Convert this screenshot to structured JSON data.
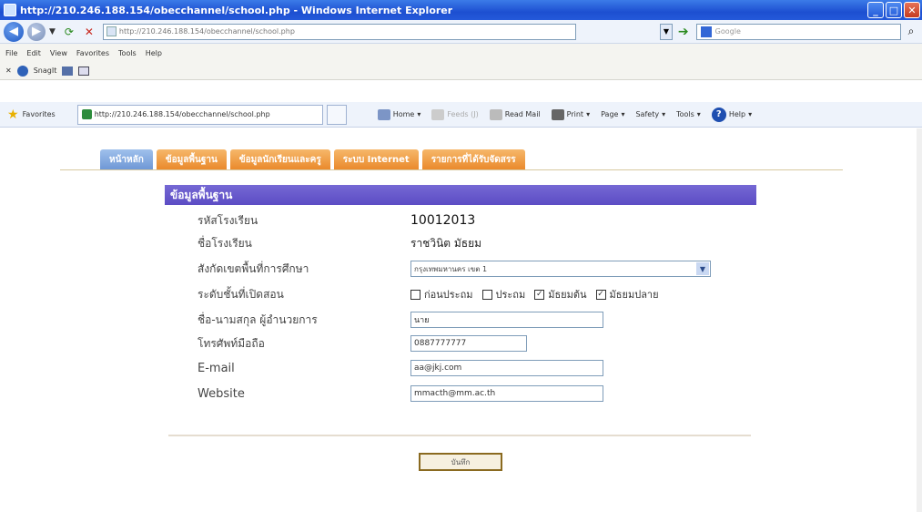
{
  "window": {
    "title": "http://210.246.188.154/obecchannel/school.php - Windows Internet Explorer",
    "min": "_",
    "max": "□",
    "close": "✕"
  },
  "address": {
    "url": "http://210.246.188.154/obecchannel/school.php",
    "search_placeholder": "Google"
  },
  "menu": {
    "items": [
      "File",
      "Edit",
      "View",
      "Favorites",
      "Tools",
      "Help"
    ]
  },
  "toolbar": {
    "snagit": "SnagIt"
  },
  "favorites_bar": {
    "favorites_label": "Favorites",
    "tab_title": "http://210.246.188.154/obecchannel/school.php",
    "home": "Home",
    "feeds": "Feeds (J)",
    "read_mail": "Read Mail",
    "print": "Print",
    "page": "Page",
    "safety": "Safety",
    "tools": "Tools",
    "help": "Help"
  },
  "nav_tabs": [
    "หน้าหลัก",
    "ข้อมูลพื้นฐาน",
    "ข้อมูลนักเรียนและครู",
    "ระบบ Internet",
    "รายการที่ได้รับจัดสรร"
  ],
  "form": {
    "heading": "ข้อมูลพื้นฐาน",
    "school_code_label": "รหัสโรงเรียน",
    "school_code": "10012013",
    "school_name_label": "ชื่อโรงเรียน",
    "school_name": "ราชวินิต มัธยม",
    "area_label": "สังกัดเขตพื้นที่การศึกษา",
    "area_value": "กรุงเทพมหานคร เขต 1",
    "levels_label": "ระดับชั้นที่เปิดสอน",
    "levels": [
      {
        "label": "ก่อนประถม",
        "checked": false
      },
      {
        "label": "ประถม",
        "checked": false
      },
      {
        "label": "มัธยมต้น",
        "checked": true
      },
      {
        "label": "มัธยมปลาย",
        "checked": true
      }
    ],
    "director_label": "ชื่อ-นามสกุล ผู้อำนวยการ",
    "director_value": "นาย",
    "phone_label": "โทรศัพท์มือถือ",
    "phone_value": "0887777777",
    "email_label": "E-mail",
    "email_value": "aa@jkj.com",
    "website_label": "Website",
    "website_value": "mmacth@mm.ac.th",
    "submit_label": "บันทึก"
  }
}
